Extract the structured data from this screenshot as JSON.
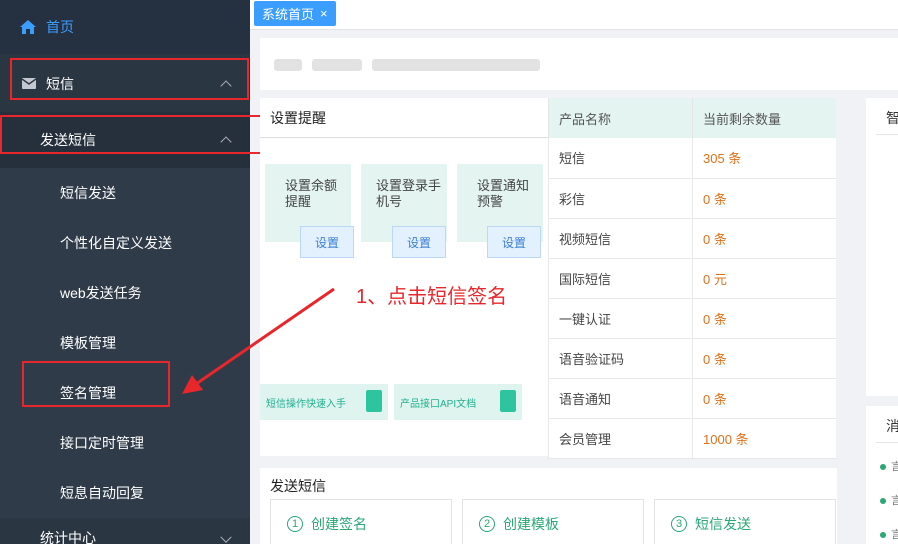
{
  "sidebar": {
    "home_label": "首页",
    "sms_label": "短信",
    "send_sms_label": "发送短信",
    "sub_items": [
      "短信发送",
      "个性化自定义发送",
      "web发送任务",
      "模板管理",
      "签名管理",
      "接口定时管理",
      "短息自动回复"
    ],
    "stats_label": "统计中心"
  },
  "tabs": {
    "active_label": "系统首页",
    "close_symbol": "×"
  },
  "settings": {
    "title": "设置提醒",
    "cards": [
      {
        "label": "设置余额提醒",
        "button": "设置"
      },
      {
        "label": "设置登录手机号",
        "button": "设置"
      },
      {
        "label": "设置通知预警",
        "button": "设置"
      }
    ],
    "quick_links": [
      "短信操作快速入手",
      "产品接口API文档"
    ]
  },
  "annotation": {
    "text": "1、点击短信签名",
    "color": "#e8262b"
  },
  "products": {
    "headers": [
      "产品名称",
      "当前剩余数量"
    ],
    "rows": [
      {
        "name": "短信",
        "qty": "305 条"
      },
      {
        "name": "彩信",
        "qty": "0 条"
      },
      {
        "name": "视频短信",
        "qty": "0 条"
      },
      {
        "name": "国际短信",
        "qty": "0 元"
      },
      {
        "name": "一键认证",
        "qty": "0 条"
      },
      {
        "name": "语音验证码",
        "qty": "0 条"
      },
      {
        "name": "语音通知",
        "qty": "0 条"
      },
      {
        "name": "会员管理",
        "qty": "1000 条"
      }
    ]
  },
  "right_panels": {
    "top_title": "智",
    "bottom_title": "消",
    "items": [
      "言",
      "言",
      "言"
    ]
  },
  "send_section": {
    "title": "发送短信",
    "steps": [
      {
        "num": "1",
        "label": "创建签名"
      },
      {
        "num": "2",
        "label": "创建模板"
      },
      {
        "num": "3",
        "label": "短信发送"
      }
    ]
  },
  "colors": {
    "accent": "#3a9dff",
    "sidebar_bg": "#2b3643",
    "success": "#2aa876",
    "warning": "#e07019",
    "highlight": "#e8262b"
  }
}
